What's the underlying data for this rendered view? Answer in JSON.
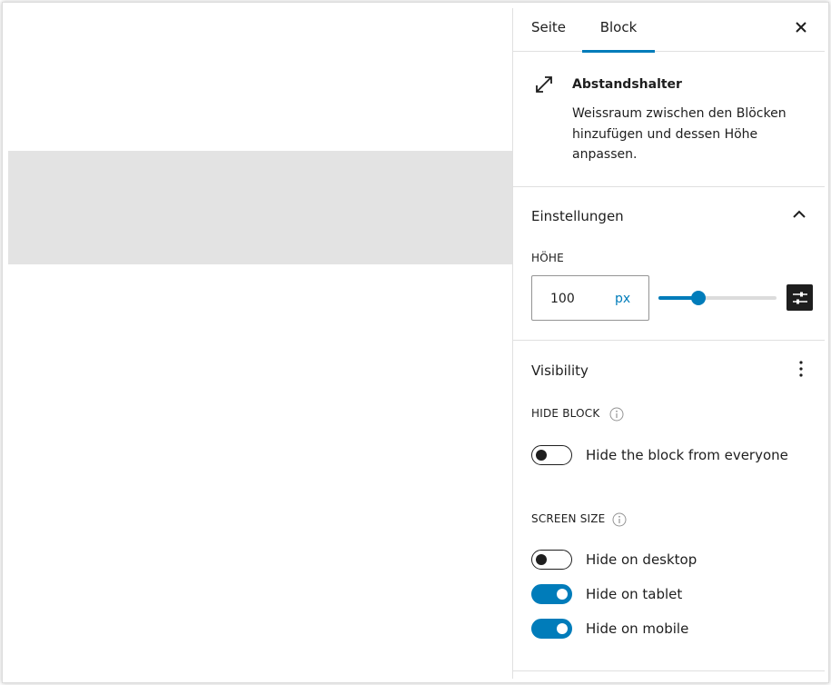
{
  "tabs": [
    {
      "label": "Seite",
      "active": false
    },
    {
      "label": "Block",
      "active": true
    }
  ],
  "close_icon": "close-icon",
  "block_card": {
    "icon": "resize-diagonal-icon",
    "title": "Abstandshalter",
    "description": "Weissraum zwischen den Blöcken hinzufügen und dessen Höhe anpassen."
  },
  "settings": {
    "title": "Einstellungen",
    "height_label": "HÖHE",
    "height_value": "100",
    "height_unit": "px",
    "slider_fraction": 0.34
  },
  "visibility": {
    "title": "Visibility",
    "hide_block_label": "HIDE BLOCK",
    "hide_everyone": {
      "label": "Hide the block from everyone",
      "checked": false
    },
    "screen_size_label": "SCREEN SIZE",
    "toggles": [
      {
        "label": "Hide on desktop",
        "checked": false
      },
      {
        "label": "Hide on tablet",
        "checked": true
      },
      {
        "label": "Hide on mobile",
        "checked": true
      }
    ]
  },
  "colors": {
    "accent": "#007cba",
    "spacer_fill": "#e3e3e3",
    "dark": "#1e1e1e"
  }
}
